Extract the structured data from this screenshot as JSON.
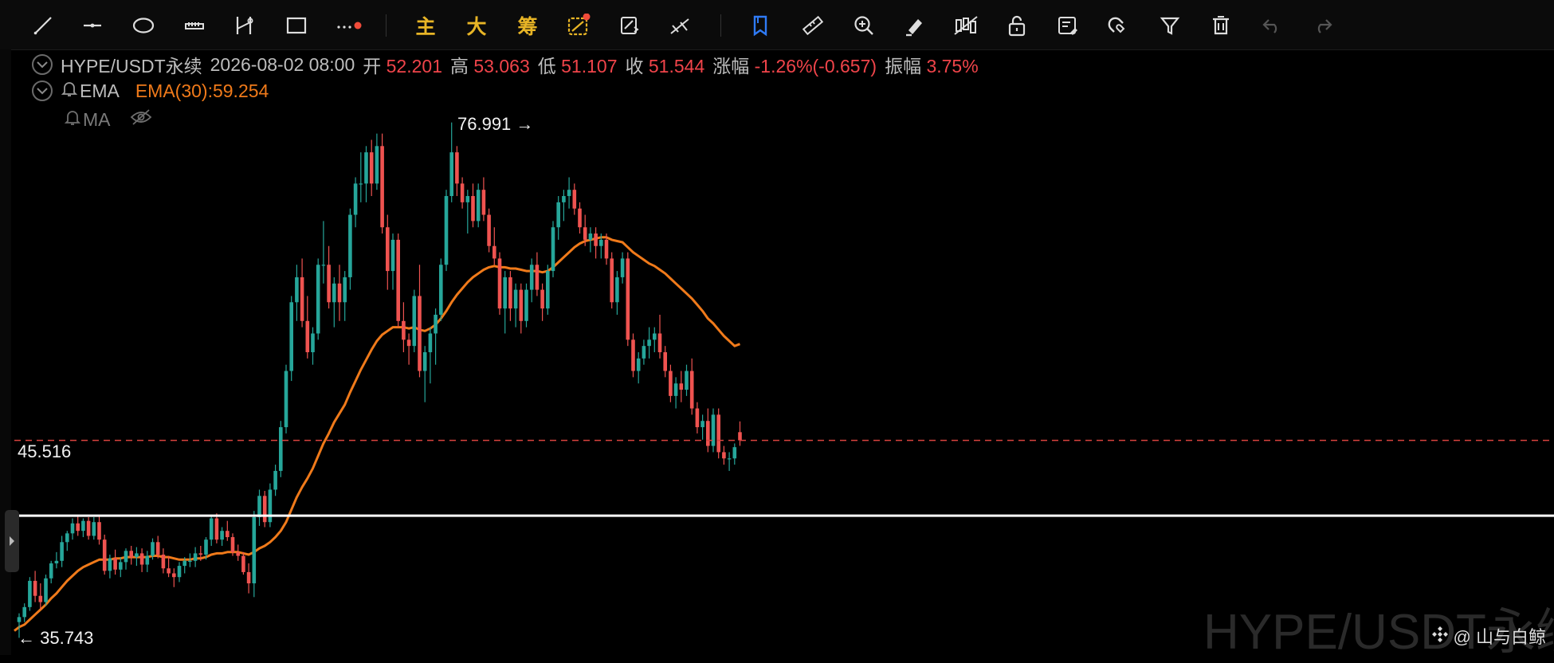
{
  "toolbar": {
    "tools": [
      "line-tool-icon",
      "horizontal-ray-icon",
      "ellipse-icon",
      "ruler-tool-icon",
      "price-range-icon",
      "rectangle-icon",
      "more-tools-icon"
    ],
    "main_label": "主",
    "big_label": "大",
    "chip_label": "筹"
  },
  "legend": {
    "symbol": "HYPE/USDT永续",
    "datetime": "2026-08-02 08:00",
    "open_label": "开",
    "open": "52.201",
    "high_label": "高",
    "high": "53.063",
    "low_label": "低",
    "low": "51.107",
    "close_label": "收",
    "close": "51.544",
    "change_label": "涨幅",
    "change": "-1.26%(-0.657)",
    "amplitude_label": "振幅",
    "amplitude": "3.75%",
    "ema_name": "EMA",
    "ema_value": "EMA(30):59.254",
    "ma_name": "MA"
  },
  "price_labels": {
    "max_high": "76.991 →",
    "resistance_line": "45.516",
    "min_low": "← 35.743"
  },
  "watermark": "HYPE/USDT永续",
  "attribution": "@ 山与白鲸",
  "colors": {
    "up": "#26a69a",
    "down": "#ef5350",
    "ema": "#f07a1a",
    "current_line": "#d9433f",
    "level_line": "#ffffff"
  },
  "chart_data": {
    "type": "candlestick",
    "symbol": "HYPE/USDT永续",
    "ylim": [
      35.0,
      78.5
    ],
    "candles_ohlc": [
      [
        37.0,
        37.7,
        35.74,
        37.4
      ],
      [
        37.4,
        38.5,
        37.0,
        38.2
      ],
      [
        38.2,
        40.6,
        37.9,
        40.3
      ],
      [
        40.3,
        41.1,
        38.6,
        39.1
      ],
      [
        39.1,
        40.1,
        38.0,
        38.6
      ],
      [
        38.6,
        40.8,
        38.3,
        40.5
      ],
      [
        40.5,
        41.9,
        40.1,
        41.7
      ],
      [
        41.7,
        42.6,
        41.3,
        41.9
      ],
      [
        41.9,
        43.9,
        41.4,
        43.4
      ],
      [
        43.4,
        44.3,
        42.7,
        44.1
      ],
      [
        44.1,
        45.3,
        43.6,
        44.9
      ],
      [
        44.9,
        45.5,
        43.9,
        44.3
      ],
      [
        44.3,
        45.3,
        43.8,
        45.1
      ],
      [
        45.1,
        45.4,
        43.6,
        43.9
      ],
      [
        43.9,
        45.4,
        43.6,
        45.0
      ],
      [
        45.0,
        45.5,
        43.2,
        43.6
      ],
      [
        43.6,
        44.0,
        40.8,
        41.1
      ],
      [
        41.1,
        42.4,
        40.5,
        42.1
      ],
      [
        42.1,
        42.8,
        40.8,
        41.2
      ],
      [
        41.2,
        42.2,
        40.6,
        41.8
      ],
      [
        41.8,
        42.9,
        41.2,
        42.7
      ],
      [
        42.7,
        43.1,
        41.6,
        42.2
      ],
      [
        42.2,
        43.0,
        41.5,
        42.5
      ],
      [
        42.5,
        42.9,
        41.0,
        41.6
      ],
      [
        41.6,
        42.7,
        41.0,
        42.3
      ],
      [
        42.3,
        43.7,
        42.0,
        43.4
      ],
      [
        43.4,
        43.9,
        42.1,
        42.4
      ],
      [
        42.4,
        42.9,
        40.9,
        41.3
      ],
      [
        41.3,
        42.3,
        40.6,
        40.9
      ],
      [
        40.9,
        41.3,
        39.8,
        40.6
      ],
      [
        40.6,
        41.8,
        40.2,
        41.5
      ],
      [
        41.5,
        42.2,
        40.9,
        41.9
      ],
      [
        41.9,
        42.5,
        41.4,
        41.9
      ],
      [
        41.9,
        43.0,
        41.4,
        42.5
      ],
      [
        42.5,
        43.1,
        41.9,
        42.4
      ],
      [
        42.4,
        43.8,
        42.0,
        43.6
      ],
      [
        43.6,
        45.6,
        43.1,
        45.3
      ],
      [
        45.3,
        45.7,
        43.3,
        43.6
      ],
      [
        43.6,
        44.6,
        43.1,
        44.3
      ],
      [
        44.3,
        45.1,
        43.5,
        43.8
      ],
      [
        43.8,
        44.1,
        42.3,
        42.6
      ],
      [
        42.6,
        43.2,
        41.9,
        42.3
      ],
      [
        42.3,
        42.6,
        40.8,
        41.0
      ],
      [
        41.0,
        41.7,
        39.3,
        40.1
      ],
      [
        40.1,
        45.9,
        39.0,
        45.4
      ],
      [
        45.4,
        47.6,
        44.7,
        47.1
      ],
      [
        47.1,
        47.5,
        44.6,
        45.0
      ],
      [
        45.0,
        48.1,
        44.6,
        47.6
      ],
      [
        47.6,
        49.6,
        47.1,
        49.1
      ],
      [
        49.1,
        53.1,
        48.6,
        52.6
      ],
      [
        52.6,
        57.6,
        52.1,
        57.1
      ],
      [
        57.1,
        63.1,
        56.3,
        62.6
      ],
      [
        62.6,
        65.6,
        61.1,
        64.6
      ],
      [
        64.6,
        66.1,
        60.6,
        61.1
      ],
      [
        61.1,
        63.1,
        58.1,
        58.6
      ],
      [
        58.6,
        60.6,
        57.6,
        60.1
      ],
      [
        60.1,
        66.1,
        59.6,
        65.6
      ],
      [
        65.6,
        69.1,
        64.1,
        65.6
      ],
      [
        65.6,
        67.1,
        62.1,
        62.6
      ],
      [
        62.6,
        64.6,
        60.6,
        64.1
      ],
      [
        64.1,
        65.6,
        61.1,
        62.6
      ],
      [
        62.6,
        65.1,
        61.1,
        64.6
      ],
      [
        64.6,
        70.1,
        63.6,
        69.6
      ],
      [
        69.6,
        72.6,
        68.6,
        72.1
      ],
      [
        72.1,
        74.6,
        70.6,
        72.1
      ],
      [
        72.1,
        75.1,
        70.6,
        74.6
      ],
      [
        74.6,
        75.6,
        71.1,
        72.1
      ],
      [
        72.1,
        76.1,
        71.6,
        75.1
      ],
      [
        75.1,
        76.1,
        68.1,
        68.6
      ],
      [
        68.6,
        69.6,
        63.6,
        65.1
      ],
      [
        65.1,
        68.1,
        63.6,
        67.6
      ],
      [
        67.6,
        68.1,
        60.6,
        61.1
      ],
      [
        61.1,
        62.6,
        58.6,
        59.6
      ],
      [
        59.6,
        60.1,
        57.6,
        59.1
      ],
      [
        59.1,
        63.6,
        58.6,
        63.1
      ],
      [
        63.1,
        65.6,
        56.6,
        57.1
      ],
      [
        57.1,
        59.1,
        54.6,
        58.6
      ],
      [
        58.6,
        60.6,
        56.1,
        60.1
      ],
      [
        60.1,
        62.1,
        57.6,
        61.6
      ],
      [
        61.6,
        66.1,
        61.1,
        65.6
      ],
      [
        65.6,
        71.6,
        65.1,
        71.1
      ],
      [
        71.1,
        76.99,
        70.6,
        74.6
      ],
      [
        74.6,
        75.1,
        71.1,
        72.1
      ],
      [
        72.1,
        72.6,
        70.1,
        70.6
      ],
      [
        70.6,
        71.6,
        68.1,
        71.1
      ],
      [
        71.1,
        72.1,
        68.6,
        69.1
      ],
      [
        69.1,
        72.1,
        68.6,
        71.6
      ],
      [
        71.6,
        72.6,
        69.1,
        69.6
      ],
      [
        69.6,
        70.1,
        66.6,
        67.1
      ],
      [
        67.1,
        68.6,
        65.6,
        66.1
      ],
      [
        66.1,
        66.6,
        61.6,
        62.1
      ],
      [
        62.1,
        65.1,
        60.1,
        64.6
      ],
      [
        64.6,
        65.1,
        61.1,
        62.1
      ],
      [
        62.1,
        64.1,
        60.6,
        63.6
      ],
      [
        63.6,
        64.1,
        60.1,
        61.1
      ],
      [
        61.1,
        64.1,
        60.6,
        63.6
      ],
      [
        63.6,
        66.1,
        62.6,
        65.6
      ],
      [
        65.6,
        66.6,
        63.1,
        63.6
      ],
      [
        63.6,
        64.1,
        61.1,
        62.1
      ],
      [
        62.1,
        65.6,
        61.6,
        65.1
      ],
      [
        65.1,
        69.1,
        64.6,
        68.6
      ],
      [
        68.6,
        71.1,
        67.6,
        70.6
      ],
      [
        70.6,
        71.6,
        69.1,
        71.1
      ],
      [
        71.1,
        72.6,
        70.1,
        71.6
      ],
      [
        71.6,
        72.1,
        69.6,
        70.1
      ],
      [
        70.1,
        70.6,
        68.1,
        68.6
      ],
      [
        68.6,
        69.6,
        67.1,
        67.6
      ],
      [
        67.6,
        68.6,
        66.6,
        68.1
      ],
      [
        68.1,
        68.6,
        66.1,
        67.1
      ],
      [
        67.1,
        68.1,
        66.1,
        67.6
      ],
      [
        67.6,
        68.1,
        65.6,
        66.1
      ],
      [
        66.1,
        66.6,
        62.1,
        62.6
      ],
      [
        62.6,
        65.1,
        61.6,
        64.6
      ],
      [
        64.6,
        66.6,
        64.1,
        66.1
      ],
      [
        66.1,
        66.6,
        59.1,
        59.6
      ],
      [
        59.6,
        60.1,
        56.6,
        57.1
      ],
      [
        57.1,
        58.6,
        56.1,
        58.1
      ],
      [
        58.1,
        59.6,
        57.6,
        59.1
      ],
      [
        59.1,
        60.6,
        58.1,
        59.6
      ],
      [
        59.6,
        60.6,
        58.6,
        60.1
      ],
      [
        60.1,
        61.6,
        58.1,
        58.6
      ],
      [
        58.6,
        59.1,
        56.6,
        57.1
      ],
      [
        57.1,
        57.6,
        54.6,
        55.1
      ],
      [
        55.1,
        56.6,
        54.1,
        56.1
      ],
      [
        56.1,
        57.1,
        54.6,
        55.6
      ],
      [
        55.6,
        57.6,
        55.1,
        57.1
      ],
      [
        57.1,
        58.1,
        53.6,
        54.1
      ],
      [
        54.1,
        54.6,
        52.1,
        52.6
      ],
      [
        52.6,
        53.6,
        51.6,
        53.1
      ],
      [
        53.1,
        54.1,
        50.6,
        51.1
      ],
      [
        51.1,
        54.1,
        50.6,
        53.6
      ],
      [
        53.6,
        54.1,
        50.1,
        50.6
      ],
      [
        50.6,
        51.1,
        49.6,
        50.1
      ],
      [
        50.1,
        50.6,
        49.1,
        50.1
      ],
      [
        50.1,
        51.3,
        49.6,
        51.0
      ],
      [
        52.201,
        53.063,
        51.107,
        51.544
      ]
    ],
    "ema30": [
      36.6,
      36.8,
      37.2,
      37.6,
      38.0,
      38.4,
      38.9,
      39.3,
      39.8,
      40.3,
      40.7,
      41.1,
      41.4,
      41.6,
      41.8,
      42.0,
      42.0,
      42.0,
      42.1,
      42.1,
      42.2,
      42.2,
      42.2,
      42.2,
      42.2,
      42.3,
      42.3,
      42.2,
      42.2,
      42.1,
      42.0,
      42.0,
      42.0,
      42.1,
      42.1,
      42.2,
      42.4,
      42.5,
      42.5,
      42.6,
      42.6,
      42.6,
      42.5,
      42.4,
      42.6,
      42.9,
      43.1,
      43.4,
      43.8,
      44.3,
      45.0,
      46.0,
      47.0,
      47.8,
      48.5,
      49.3,
      50.3,
      51.3,
      52.1,
      53.0,
      53.7,
      54.4,
      55.4,
      56.3,
      57.2,
      58.0,
      58.8,
      59.5,
      60.0,
      60.3,
      60.6,
      60.6,
      60.6,
      60.5,
      60.6,
      60.4,
      60.3,
      60.5,
      60.8,
      61.3,
      61.9,
      62.6,
      63.2,
      63.7,
      64.2,
      64.6,
      64.9,
      65.2,
      65.4,
      65.5,
      65.4,
      65.4,
      65.3,
      65.3,
      65.2,
      65.1,
      65.1,
      65.1,
      65.0,
      65.1,
      65.4,
      65.8,
      66.2,
      66.6,
      67.0,
      67.3,
      67.5,
      67.6,
      67.7,
      67.8,
      67.8,
      67.6,
      67.5,
      67.4,
      67.0,
      66.6,
      66.3,
      66.0,
      65.7,
      65.5,
      65.2,
      64.9,
      64.5,
      64.1,
      63.7,
      63.3,
      62.9,
      62.4,
      61.9,
      61.3,
      60.9,
      60.4,
      59.9,
      59.5,
      59.1,
      59.254
    ]
  }
}
